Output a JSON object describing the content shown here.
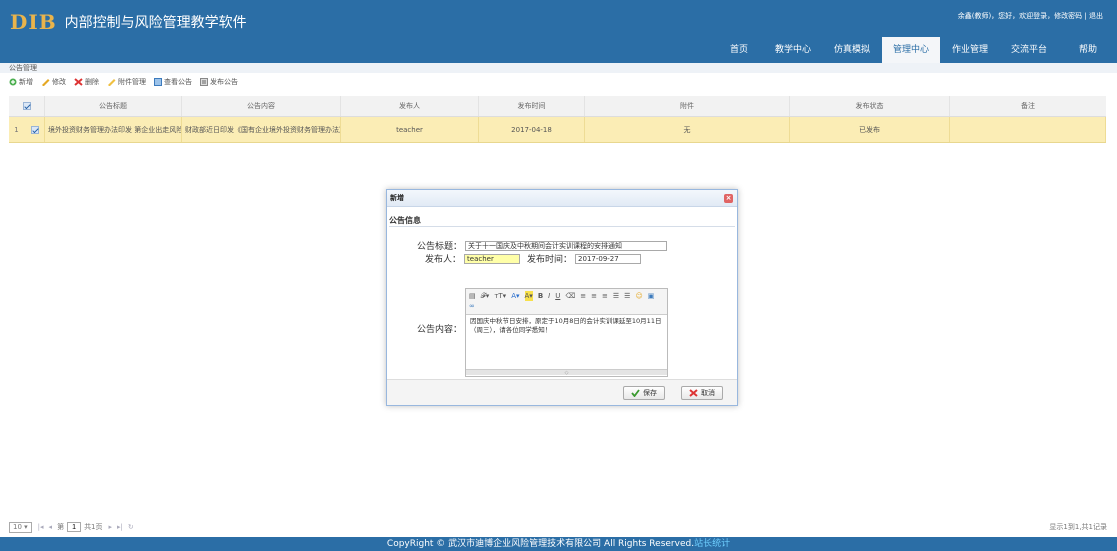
{
  "app": {
    "logo": "DIB",
    "title": "内部控制与风险管理教学软件",
    "user_links": "余鑫(教师)，您好，欢迎登录，修改密码 | 退出"
  },
  "nav": [
    "首页",
    "教学中心",
    "仿真模拟",
    "管理中心",
    "作业管理",
    "交流平台",
    "帮助"
  ],
  "panel_title": "公告管理",
  "toolbar": {
    "add": "新增",
    "edit": "修改",
    "delete": "删除",
    "attachment": "附件管理",
    "view": "查看公告",
    "publish": "发布公告"
  },
  "grid": {
    "headers": [
      "公告标题",
      "公告内容",
      "发布人",
      "发布时间",
      "附件",
      "发布状态",
      "备注"
    ],
    "rows": [
      {
        "num": "1",
        "title": "境外投资财务管理办法印发 第企业出走风险如何防",
        "content": "财政部近日印发《国有企业境外投资财务管理办法》()",
        "publisher": "teacher",
        "date": "2017-04-18",
        "attachment": "无",
        "status": "已发布",
        "note": ""
      }
    ]
  },
  "pager": {
    "page_size": "10",
    "page_label": "第",
    "page_value": "1",
    "total_pages": "共1页",
    "info": "显示1到1,共1记录"
  },
  "footer": {
    "text": "CopyRight © 武汉市迪博企业风险管理技术有限公司 All Rights Reserved.",
    "link": "站长统计"
  },
  "dialog": {
    "title": "新增",
    "section": "公告信息",
    "title_label": "公告标题：",
    "title_value": "关于十一国庆及中秋期间会计实训课程的安排通知",
    "publisher_label": "发布人：",
    "publisher_value": "teacher",
    "date_label": "发布时间：",
    "date_value": "2017-09-27",
    "content_label": "公告内容：",
    "content_value": "因国庆中秋节日安排，原定于10月8日的会计实训课延至10月11日（周三），请各位同学悉知！",
    "save": "保存",
    "cancel": "取消"
  },
  "colors": {
    "header_bg": "#2b6ea6",
    "row_selected": "#fbedb5"
  }
}
